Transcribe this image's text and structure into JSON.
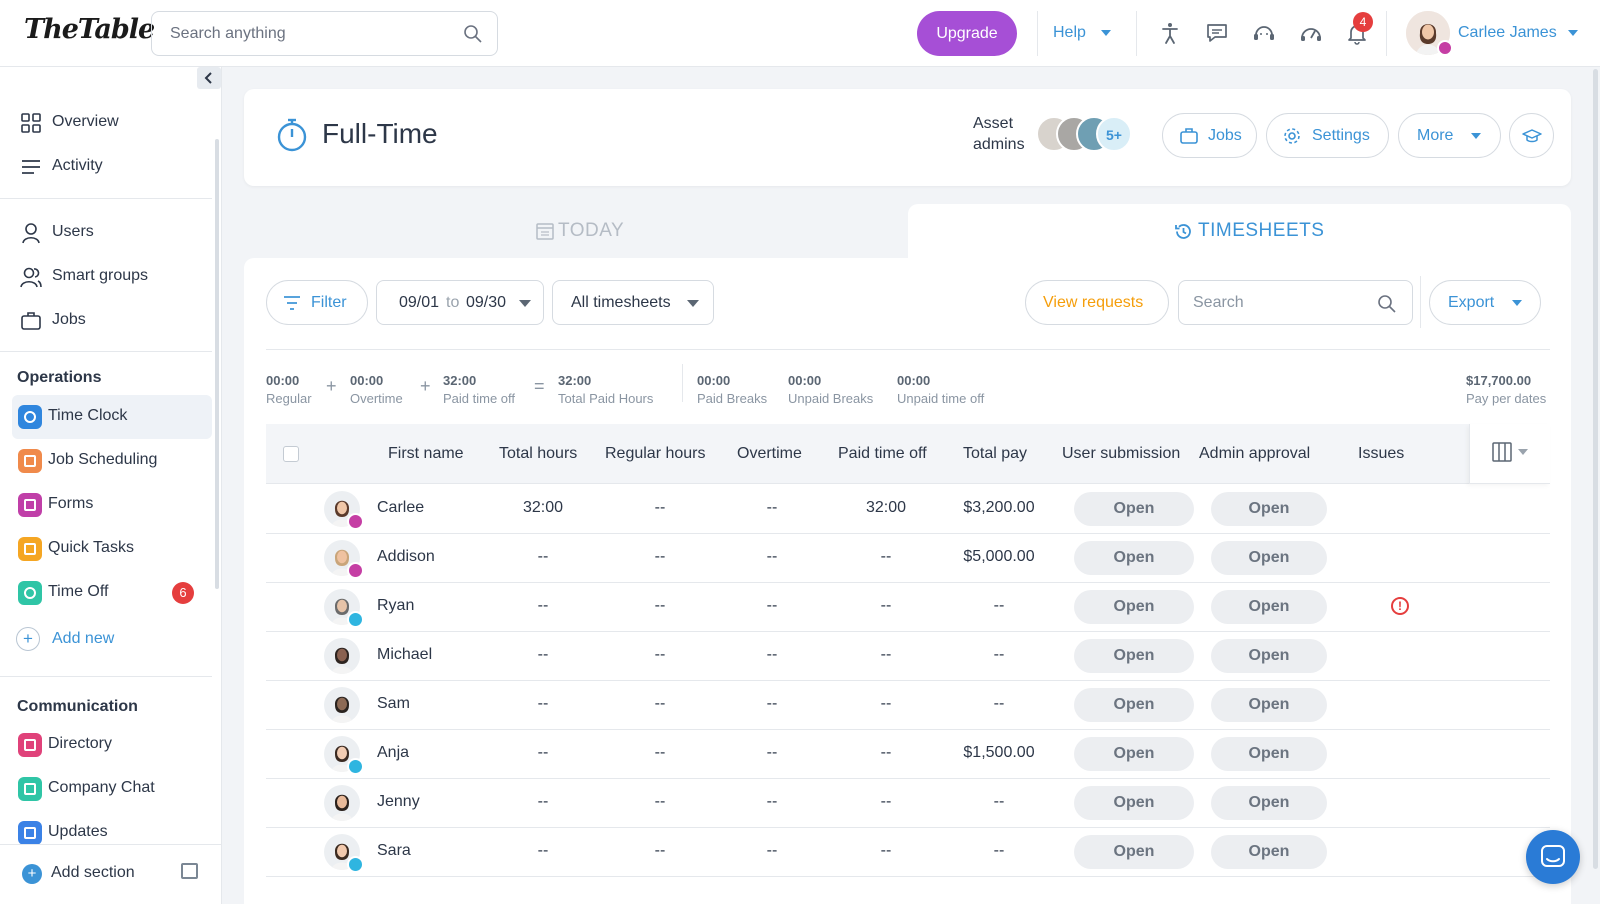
{
  "app": {
    "logo": "TheTable"
  },
  "topbar": {
    "search_placeholder": "Search anything",
    "upgrade_label": "Upgrade",
    "help_label": "Help",
    "notification_count": "4",
    "user_name": "Carlee James"
  },
  "sidebar": {
    "main": [
      {
        "label": "Overview",
        "icon": "grid-icon"
      },
      {
        "label": "Activity",
        "icon": "list-icon"
      },
      {
        "label": "Users",
        "icon": "user-icon"
      },
      {
        "label": "Smart groups",
        "icon": "users-icon"
      },
      {
        "label": "Jobs",
        "icon": "briefcase-icon"
      }
    ],
    "operations_header": "Operations",
    "operations": [
      {
        "label": "Time Clock",
        "color": "#2f86de"
      },
      {
        "label": "Job Scheduling",
        "color": "#f08a4b"
      },
      {
        "label": "Forms",
        "color": "#c03fa8"
      },
      {
        "label": "Quick Tasks",
        "color": "#f5a623"
      },
      {
        "label": "Time Off",
        "color": "#2fc5a6",
        "badge": "6"
      }
    ],
    "add_new_label": "Add new",
    "communication_header": "Communication",
    "communication": [
      {
        "label": "Directory",
        "color": "#e0427a"
      },
      {
        "label": "Company Chat",
        "color": "#2fc5a6"
      },
      {
        "label": "Updates",
        "color": "#3b82e6"
      }
    ],
    "add_section_label": "Add section"
  },
  "header": {
    "title": "Full-Time",
    "asset_admins_line1": "Asset",
    "asset_admins_line2": "admins",
    "admins_more": "5+",
    "jobs_label": "Jobs",
    "settings_label": "Settings",
    "more_label": "More"
  },
  "tabs": {
    "today": "TODAY",
    "timesheets": "TIMESHEETS"
  },
  "toolbar": {
    "filter_label": "Filter",
    "date_from": "09/01",
    "date_to_word": "to",
    "date_to": "09/30",
    "timesheet_select": "All timesheets",
    "view_requests_label": "View requests",
    "search_placeholder": "Search",
    "export_label": "Export"
  },
  "summary": [
    {
      "value": "00:00",
      "label": "Regular"
    },
    {
      "value": "00:00",
      "label": "Overtime"
    },
    {
      "value": "32:00",
      "label": "Paid time off"
    },
    {
      "value": "32:00",
      "label": "Total Paid Hours"
    },
    {
      "value": "00:00",
      "label": "Paid Breaks"
    },
    {
      "value": "00:00",
      "label": "Unpaid Breaks"
    },
    {
      "value": "00:00",
      "label": "Unpaid time off"
    },
    {
      "value": "$17,700.00",
      "label": "Pay per dates"
    }
  ],
  "summary_ops": [
    "+",
    "+",
    "="
  ],
  "table": {
    "columns": [
      "First name",
      "Total hours",
      "Regular hours",
      "Overtime",
      "Paid time off",
      "Total pay",
      "User submission",
      "Admin approval",
      "Issues"
    ],
    "rows": [
      {
        "name": "Carlee",
        "total": "32:00",
        "regular": "--",
        "overtime": "--",
        "pto": "32:00",
        "pay": "$3,200.00",
        "submission": "Open",
        "approval": "Open",
        "badge": "crown",
        "issue": false
      },
      {
        "name": "Addison",
        "total": "--",
        "regular": "--",
        "overtime": "--",
        "pto": "--",
        "pay": "$5,000.00",
        "submission": "Open",
        "approval": "Open",
        "badge": "crown",
        "issue": false
      },
      {
        "name": "Ryan",
        "total": "--",
        "regular": "--",
        "overtime": "--",
        "pto": "--",
        "pay": "--",
        "submission": "Open",
        "approval": "Open",
        "badge": "star",
        "issue": true
      },
      {
        "name": "Michael",
        "total": "--",
        "regular": "--",
        "overtime": "--",
        "pto": "--",
        "pay": "--",
        "submission": "Open",
        "approval": "Open",
        "badge": "",
        "issue": false
      },
      {
        "name": "Sam",
        "total": "--",
        "regular": "--",
        "overtime": "--",
        "pto": "--",
        "pay": "--",
        "submission": "Open",
        "approval": "Open",
        "badge": "",
        "issue": false
      },
      {
        "name": "Anja",
        "total": "--",
        "regular": "--",
        "overtime": "--",
        "pto": "--",
        "pay": "$1,500.00",
        "submission": "Open",
        "approval": "Open",
        "badge": "star",
        "issue": false
      },
      {
        "name": "Jenny",
        "total": "--",
        "regular": "--",
        "overtime": "--",
        "pto": "--",
        "pay": "--",
        "submission": "Open",
        "approval": "Open",
        "badge": "",
        "issue": false
      },
      {
        "name": "Sara",
        "total": "--",
        "regular": "--",
        "overtime": "--",
        "pto": "--",
        "pay": "--",
        "submission": "Open",
        "approval": "Open",
        "badge": "star",
        "issue": false
      }
    ]
  },
  "colors": {
    "accent": "#3b93d6",
    "upgrade": "#a64fd6",
    "warning": "#f59e0b",
    "danger": "#e53e3e",
    "crown_badge": "#c53ea4",
    "star_badge": "#2fb5e0"
  }
}
